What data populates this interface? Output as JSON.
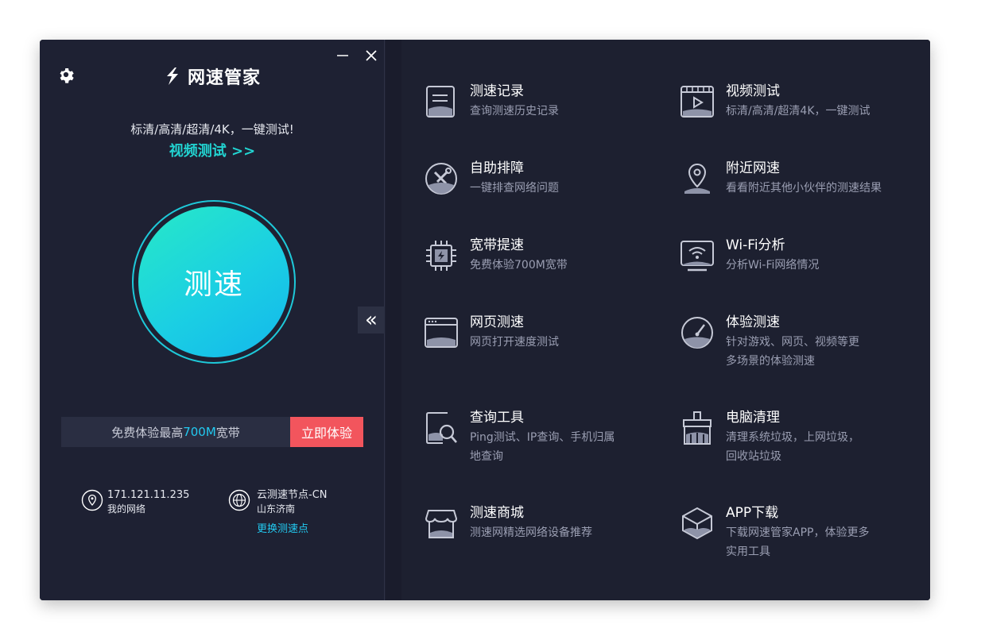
{
  "app": {
    "name": "网速管家",
    "window_controls": {
      "minimize": "minimize",
      "close": "close"
    }
  },
  "left": {
    "promo_line": "标清/高清/超清/4K，一键测试!",
    "promo_link": "视频测试 >>",
    "speed_button": "测速",
    "trial": {
      "prefix": "免费体验最高",
      "highlight": "700M",
      "suffix": "宽带",
      "button": "立即体验"
    },
    "network": {
      "ip": "171.121.11.235",
      "label": "我的网络"
    },
    "node": {
      "name": "云测速节点-CN",
      "location": "山东济南",
      "change": "更换测速点"
    },
    "collapse_glyph": "«"
  },
  "features": [
    {
      "title": "测速记录",
      "desc1": "查询测速历史记录",
      "desc2": "",
      "icon": "record-icon"
    },
    {
      "title": "视频测试",
      "desc1": "标清/高清/超清4K，一键测试",
      "desc2": "",
      "icon": "video-icon"
    },
    {
      "title": "自助排障",
      "desc1": "一键排查网络问题",
      "desc2": "",
      "icon": "tools-icon"
    },
    {
      "title": "附近网速",
      "desc1": "看看附近其他小伙伴的测速结果",
      "desc2": "",
      "icon": "location-icon"
    },
    {
      "title": "宽带提速",
      "desc1": "免费体验700M宽带",
      "desc2": "",
      "icon": "chip-icon"
    },
    {
      "title": "Wi-Fi分析",
      "desc1": "分析Wi-Fi网络情况",
      "desc2": "",
      "icon": "wifi-icon"
    },
    {
      "title": "网页测速",
      "desc1": "网页打开速度测试",
      "desc2": "",
      "icon": "webpage-icon"
    },
    {
      "title": "体验测速",
      "desc1": "针对游戏、网页、视频等更",
      "desc2": "多场景的体验测速",
      "icon": "speedometer-icon"
    },
    {
      "title": "查询工具",
      "desc1": "Ping测试、IP查询、手机归属",
      "desc2": "地查询",
      "icon": "search-tool-icon"
    },
    {
      "title": "电脑清理",
      "desc1": "清理系统垃圾，上网垃圾，",
      "desc2": "回收站垃圾",
      "icon": "broom-icon"
    },
    {
      "title": "测速商城",
      "desc1": "测速网精选网络设备推荐",
      "desc2": "",
      "icon": "store-icon"
    },
    {
      "title": "APP下载",
      "desc1": "下载网速管家APP，体验更多",
      "desc2": "实用工具",
      "icon": "box-icon"
    }
  ],
  "colors": {
    "accent": "#22d3d1",
    "link": "#22c9f0",
    "cta": "#f2555d",
    "bg": "#1e2133"
  }
}
